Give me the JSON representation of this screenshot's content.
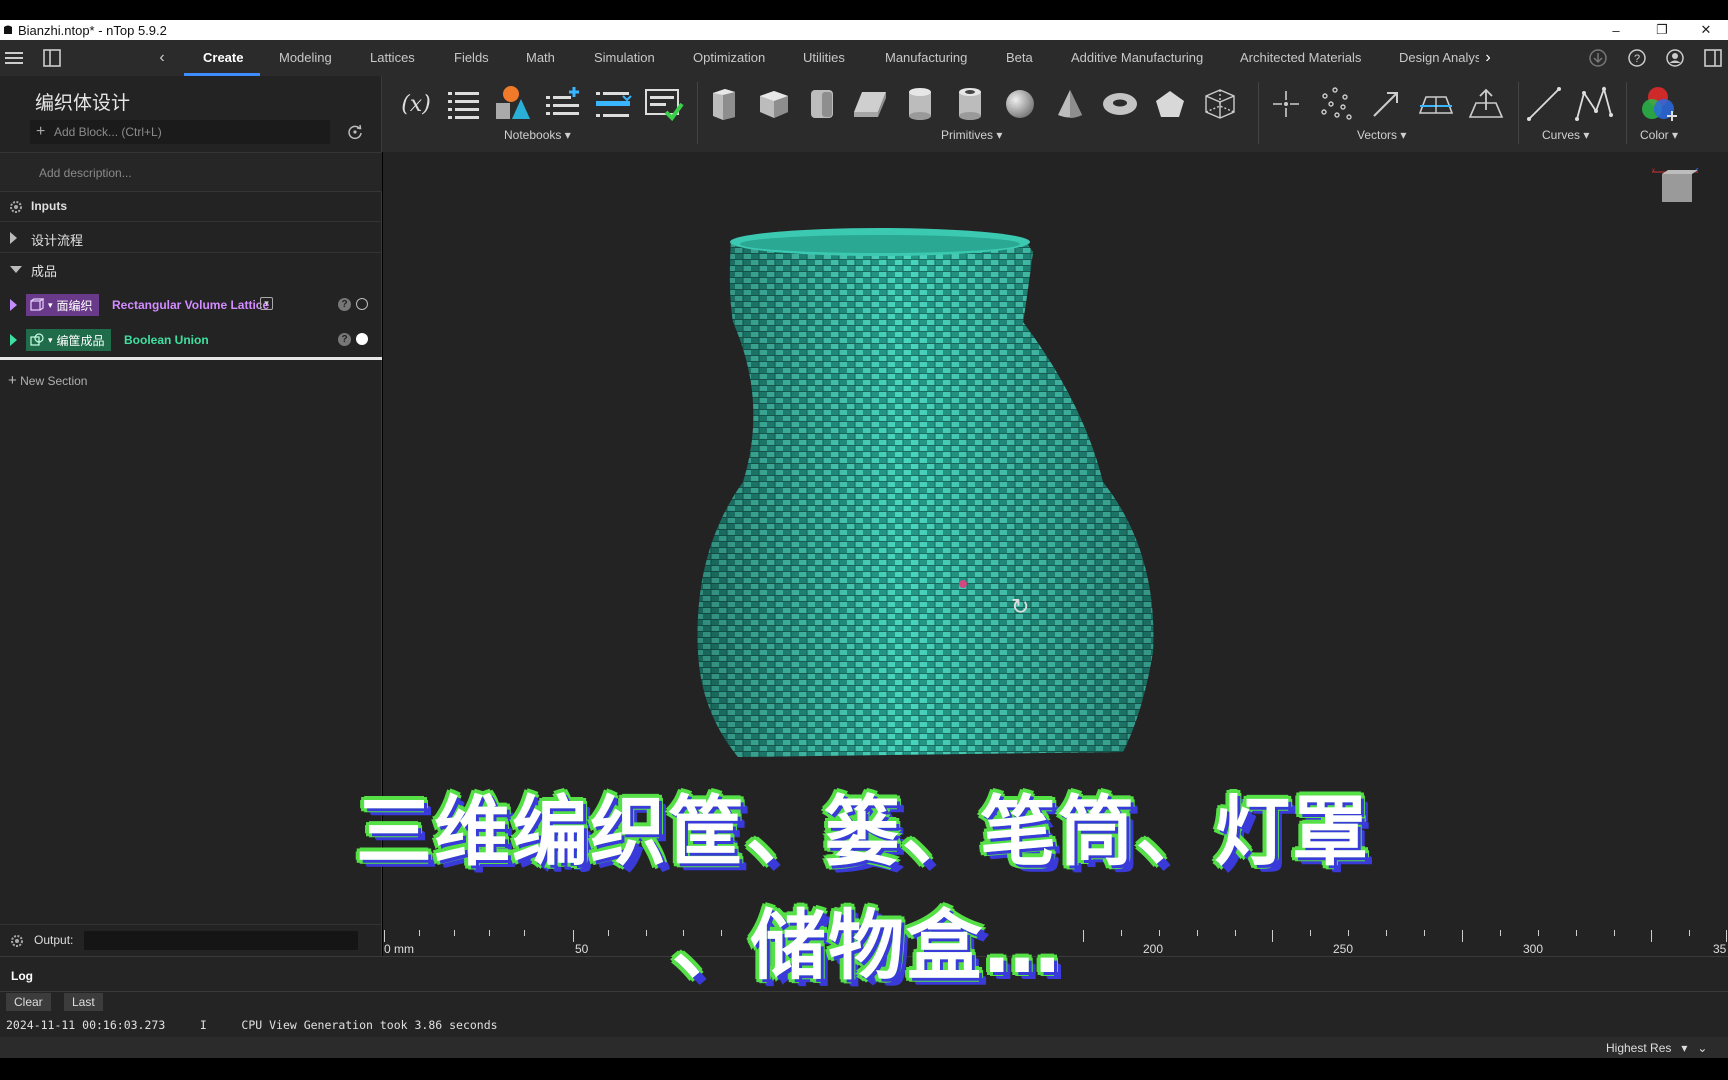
{
  "window": {
    "title": "Bianzhi.ntop* - nTop 5.9.2",
    "controls": [
      "–",
      "❐",
      "✕"
    ]
  },
  "ribbon": {
    "tabs": [
      "Create",
      "Modeling",
      "Lattices",
      "Fields",
      "Math",
      "Simulation",
      "Optimization",
      "Utilities",
      "Manufacturing",
      "Beta",
      "Additive Manufacturing",
      "Architected Materials",
      "Design Analys"
    ],
    "active_tab": "Create",
    "groups": {
      "notebooks": "Notebooks",
      "primitives": "Primitives",
      "vectors": "Vectors",
      "curves": "Curves",
      "color": "Color"
    },
    "variable_icon_text": "(x)"
  },
  "notebook": {
    "title": "编织体设计",
    "add_block_placeholder": "Add Block... (Ctrl+L)",
    "description_placeholder": "Add description...",
    "inputs_label": "Inputs",
    "sections": [
      {
        "label": "设计流程",
        "expanded": false
      },
      {
        "label": "成品",
        "expanded": true
      }
    ],
    "blocks": [
      {
        "tag": "面编织",
        "type": "Rectangular Volume Lattice",
        "tag_color": "#6a3a8a",
        "type_color": "#d28cff"
      },
      {
        "tag": "编筐成品",
        "type": "Boolean Union",
        "tag_color": "#1f6b4a",
        "type_color": "#3ee0a0"
      }
    ],
    "new_section_label": "New Section",
    "output_label": "Output:"
  },
  "viewport": {
    "model_color": "#2fb5a0",
    "ruler": {
      "labels": [
        "0 mm",
        "50",
        "200",
        "250",
        "300",
        "35"
      ]
    }
  },
  "log": {
    "tab_label": "Log",
    "clear_label": "Clear",
    "last_label": "Last",
    "entry": "2024-11-11 00:16:03.273     I     CPU View Generation took 3.86 seconds",
    "resolution": "Highest Res"
  },
  "subtitles": {
    "line1": "三维编织筐、篓、笔筒、灯罩",
    "line2": "、储物盒…"
  }
}
